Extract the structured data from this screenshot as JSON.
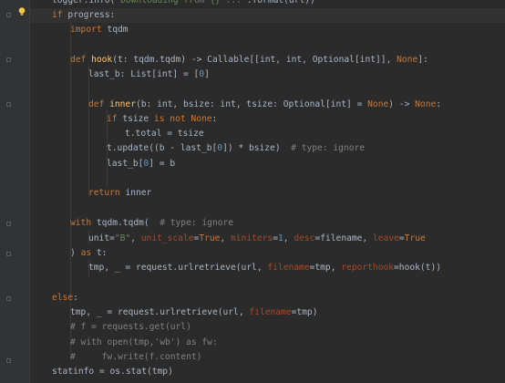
{
  "editor": {
    "language": "python",
    "colors": {
      "background": "#2b2b2b",
      "gutter": "#313335",
      "keyword": "#cc7832",
      "function": "#ffc66d",
      "string": "#6a8759",
      "number": "#6897bb",
      "comment": "#808080",
      "kwarg": "#aa4926",
      "text": "#a9b7c6"
    },
    "gutter_icons": [
      "lightbulb-icon",
      "fold-marker-icon"
    ],
    "lines": [
      [
        [
          "n",
          "logger.info("
        ],
        [
          "str",
          "\"Downloading from {} ...\""
        ],
        [
          "n",
          ".format(url))"
        ]
      ],
      [
        [
          "kw",
          "if "
        ],
        [
          "n",
          "progress:"
        ]
      ],
      [
        [
          "kw",
          "import "
        ],
        [
          "n",
          "tqdm"
        ]
      ],
      [],
      [
        [
          "kw",
          "def "
        ],
        [
          "fn",
          "hook"
        ],
        [
          "n",
          "(t: tqdm.tqdm) -> Callable[[int, int, Optional[int]], "
        ],
        [
          "kw",
          "None"
        ],
        [
          "n",
          "]:"
        ]
      ],
      [
        [
          "n",
          "last_b: List[int] = ["
        ],
        [
          "num",
          "0"
        ],
        [
          "n",
          "]"
        ]
      ],
      [],
      [
        [
          "kw",
          "def "
        ],
        [
          "fn",
          "inner"
        ],
        [
          "n",
          "(b: int, bsize: int, tsize: Optional[int] = "
        ],
        [
          "kw",
          "None"
        ],
        [
          "n",
          ") -> "
        ],
        [
          "kw",
          "None"
        ],
        [
          "n",
          ":"
        ]
      ],
      [
        [
          "kw",
          "if "
        ],
        [
          "n",
          "tsize "
        ],
        [
          "kw",
          "is not None"
        ],
        [
          "n",
          ":"
        ]
      ],
      [
        [
          "n",
          "t.total = tsize"
        ]
      ],
      [
        [
          "n",
          "t.update((b - last_b["
        ],
        [
          "num",
          "0"
        ],
        [
          "n",
          "]) * bsize)  "
        ],
        [
          "cm",
          "# type: ignore"
        ]
      ],
      [
        [
          "n",
          "last_b["
        ],
        [
          "num",
          "0"
        ],
        [
          "n",
          "] = b"
        ]
      ],
      [],
      [
        [
          "kw",
          "return "
        ],
        [
          "n",
          "inner"
        ]
      ],
      [],
      [
        [
          "kw",
          "with "
        ],
        [
          "n",
          "tqdm.tqdm(  "
        ],
        [
          "cm",
          "# type: ignore"
        ]
      ],
      [
        [
          "n",
          "unit="
        ],
        [
          "str",
          "\"B\""
        ],
        [
          "n",
          ", "
        ],
        [
          "kwarg",
          "unit_scale"
        ],
        [
          "n",
          "="
        ],
        [
          "kw",
          "True"
        ],
        [
          "n",
          ", "
        ],
        [
          "kwarg",
          "miniters"
        ],
        [
          "n",
          "="
        ],
        [
          "num",
          "1"
        ],
        [
          "n",
          ", "
        ],
        [
          "kwarg",
          "desc"
        ],
        [
          "n",
          "=filename, "
        ],
        [
          "kwarg",
          "leave"
        ],
        [
          "n",
          "="
        ],
        [
          "kw",
          "True"
        ]
      ],
      [
        [
          "n",
          ") "
        ],
        [
          "kw",
          "as "
        ],
        [
          "n",
          "t:"
        ]
      ],
      [
        [
          "n",
          "tmp, _ = request.urlretrieve(url, "
        ],
        [
          "kwarg",
          "filename"
        ],
        [
          "n",
          "=tmp, "
        ],
        [
          "kwarg",
          "reporthook"
        ],
        [
          "n",
          "=hook(t))"
        ]
      ],
      [],
      [
        [
          "kw",
          "else"
        ],
        [
          "n",
          ":"
        ]
      ],
      [
        [
          "n",
          "tmp, _ = request.urlretrieve(url, "
        ],
        [
          "kwarg",
          "filename"
        ],
        [
          "n",
          "=tmp)"
        ]
      ],
      [
        [
          "cm",
          "# f = requests.get(url)"
        ]
      ],
      [
        [
          "cm",
          "# with open(tmp,'wb') as fw:"
        ]
      ],
      [
        [
          "cm",
          "#     fw.write(f.content)"
        ]
      ],
      [
        [
          "n",
          "statinfo = os.stat(tmp)"
        ]
      ]
    ]
  }
}
